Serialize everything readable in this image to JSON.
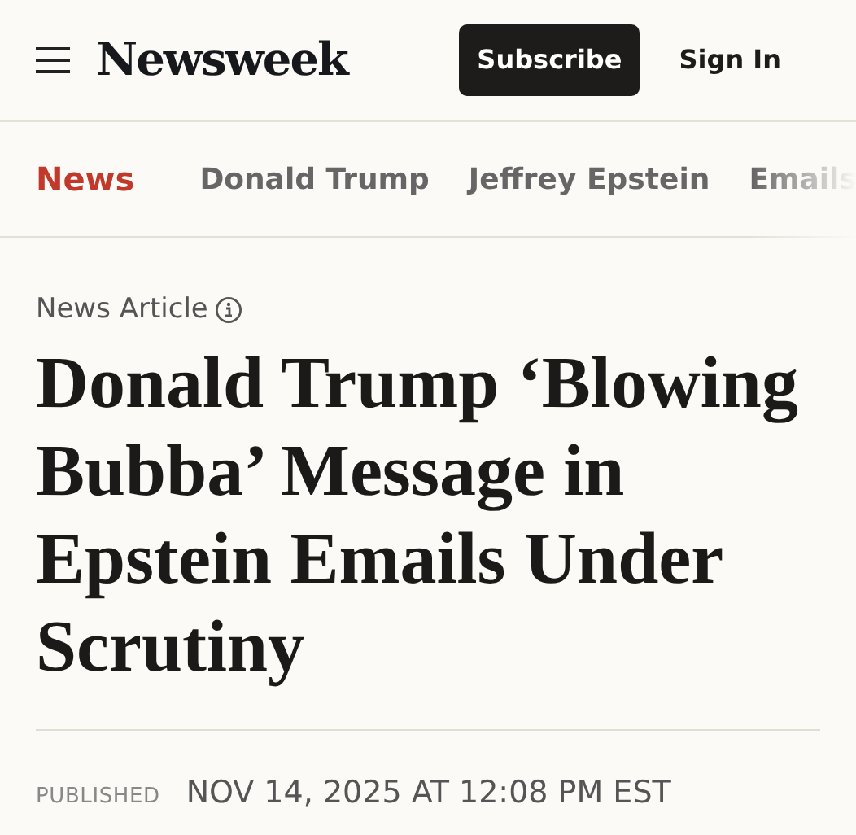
{
  "header": {
    "logo": "Newsweek",
    "subscribe": "Subscribe",
    "sign_in": "Sign In"
  },
  "nav": [
    {
      "label": "News",
      "selected": true
    },
    {
      "label": "Donald Trump",
      "selected": false
    },
    {
      "label": "Jeffrey Epstein",
      "selected": false
    },
    {
      "label": "Emails",
      "selected": false
    }
  ],
  "article": {
    "type_label": "News Article",
    "headline": "Donald Trump ‘Blowing Bubba’ Message in Epstein Emails Under Scrutiny",
    "published_label": "PUBLISHED",
    "published_date": "NOV 14, 2025 AT 12:08 PM EST"
  }
}
